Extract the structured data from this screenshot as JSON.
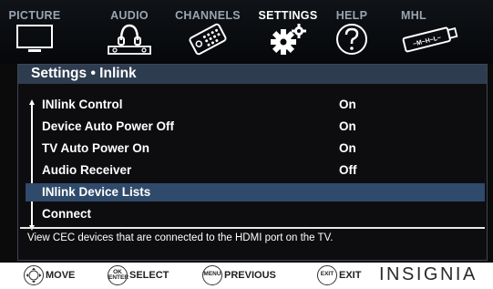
{
  "tabs": [
    {
      "label": "PICTURE",
      "icon": "tv-icon"
    },
    {
      "label": "AUDIO",
      "icon": "headphones-icon"
    },
    {
      "label": "CHANNELS",
      "icon": "remote-icon"
    },
    {
      "label": "SETTINGS",
      "icon": "gear-icon",
      "active": true
    },
    {
      "label": "HELP",
      "icon": "question-icon"
    },
    {
      "label": "MHL",
      "icon": "mhl-cable-icon"
    }
  ],
  "panel": {
    "title": "Settings  • Inlink",
    "items": [
      {
        "label": "INlink Control",
        "value": "On"
      },
      {
        "label": "Device Auto Power Off",
        "value": "On"
      },
      {
        "label": "TV Auto Power On",
        "value": "On"
      },
      {
        "label": "Audio Receiver",
        "value": "Off"
      },
      {
        "label": "INlink Device Lists",
        "value": "",
        "selected": true
      },
      {
        "label": "Connect",
        "value": ""
      }
    ],
    "help_text": "View CEC devices that are connected to the HDMI port on the TV."
  },
  "controls": [
    {
      "icon_text": "",
      "icon": "dpad-icon",
      "label": "MOVE"
    },
    {
      "icon_text": "OK ENTER",
      "icon": "ok-enter-icon",
      "label": "SELECT"
    },
    {
      "icon_text": "MENU",
      "icon": "menu-icon",
      "label": "PREVIOUS"
    },
    {
      "icon_text": "EXIT",
      "icon": "exit-icon",
      "label": "EXIT"
    }
  ],
  "brand": "INSIGNIA",
  "colors": {
    "highlight": "#2f4a6b",
    "title_bar": "#2e3c4f",
    "tab_inactive": "#9aa5b1"
  }
}
